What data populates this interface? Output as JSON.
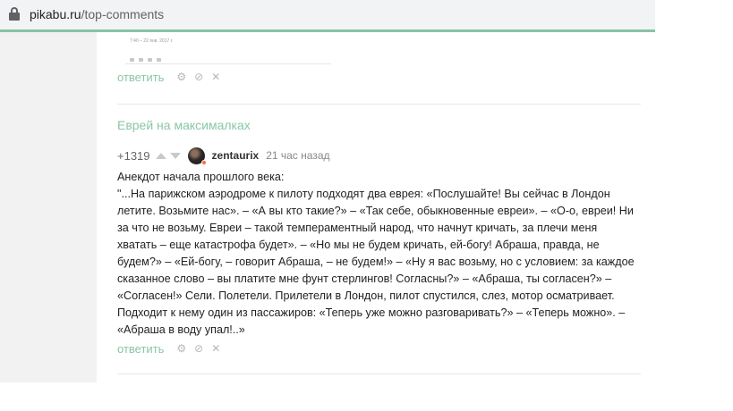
{
  "browser": {
    "url_host": "pikabu.ru",
    "url_path": "/top-comments"
  },
  "thumbnail": {
    "timestamp": "7:40 – 22 янв. 2017 г."
  },
  "previous_comment": {
    "reply_label": "ответить"
  },
  "post": {
    "title": "Еврей на максималках",
    "rating": "+1319",
    "author": "zentaurix",
    "time": "21 час назад",
    "reply_label": "ответить",
    "text_lines": [
      "Анекдот начала прошлого века:",
      "\"...На парижском аэродроме к пилоту подходят два еврея: «Послушайте! Вы сейчас в Лондон",
      "летите. Возьмите нас». – «А вы кто такие?» – «Так себе, обыкновенные евреи». – «О-о, евреи! Ни",
      "за что не возьму. Евреи – такой темпераментный народ, что начнут кричать, за плечи меня",
      "хватать – еще катастрофа будет». – «Но мы не будем кричать, ей-богу! Абраша, правда, не",
      "будем?» – «Ей-богу, – говорит Абраша, – не будем!» – «Ну я вас возьму, но с условием: за каждое",
      "сказанное слово – вы платите мне фунт стерлингов! Согласны?» – «Абраша, ты согласен?» –",
      "«Согласен!» Сели. Полетели. Прилетели в Лондон, пилот спустился, слез, мотор осматривает.",
      "Подходит к нему один из пассажиров: «Теперь уже можно разговаривать?» – «Теперь можно». –",
      "«Абраша в воду упал!..»"
    ]
  },
  "icons": {
    "settings": "gear-icon",
    "block": "block-icon",
    "close": "close-icon",
    "upvote": "arrow-up-icon",
    "downvote": "arrow-down-icon"
  },
  "colors": {
    "accent": "#8ac7a4",
    "online_dot": "#ff6d3a"
  }
}
